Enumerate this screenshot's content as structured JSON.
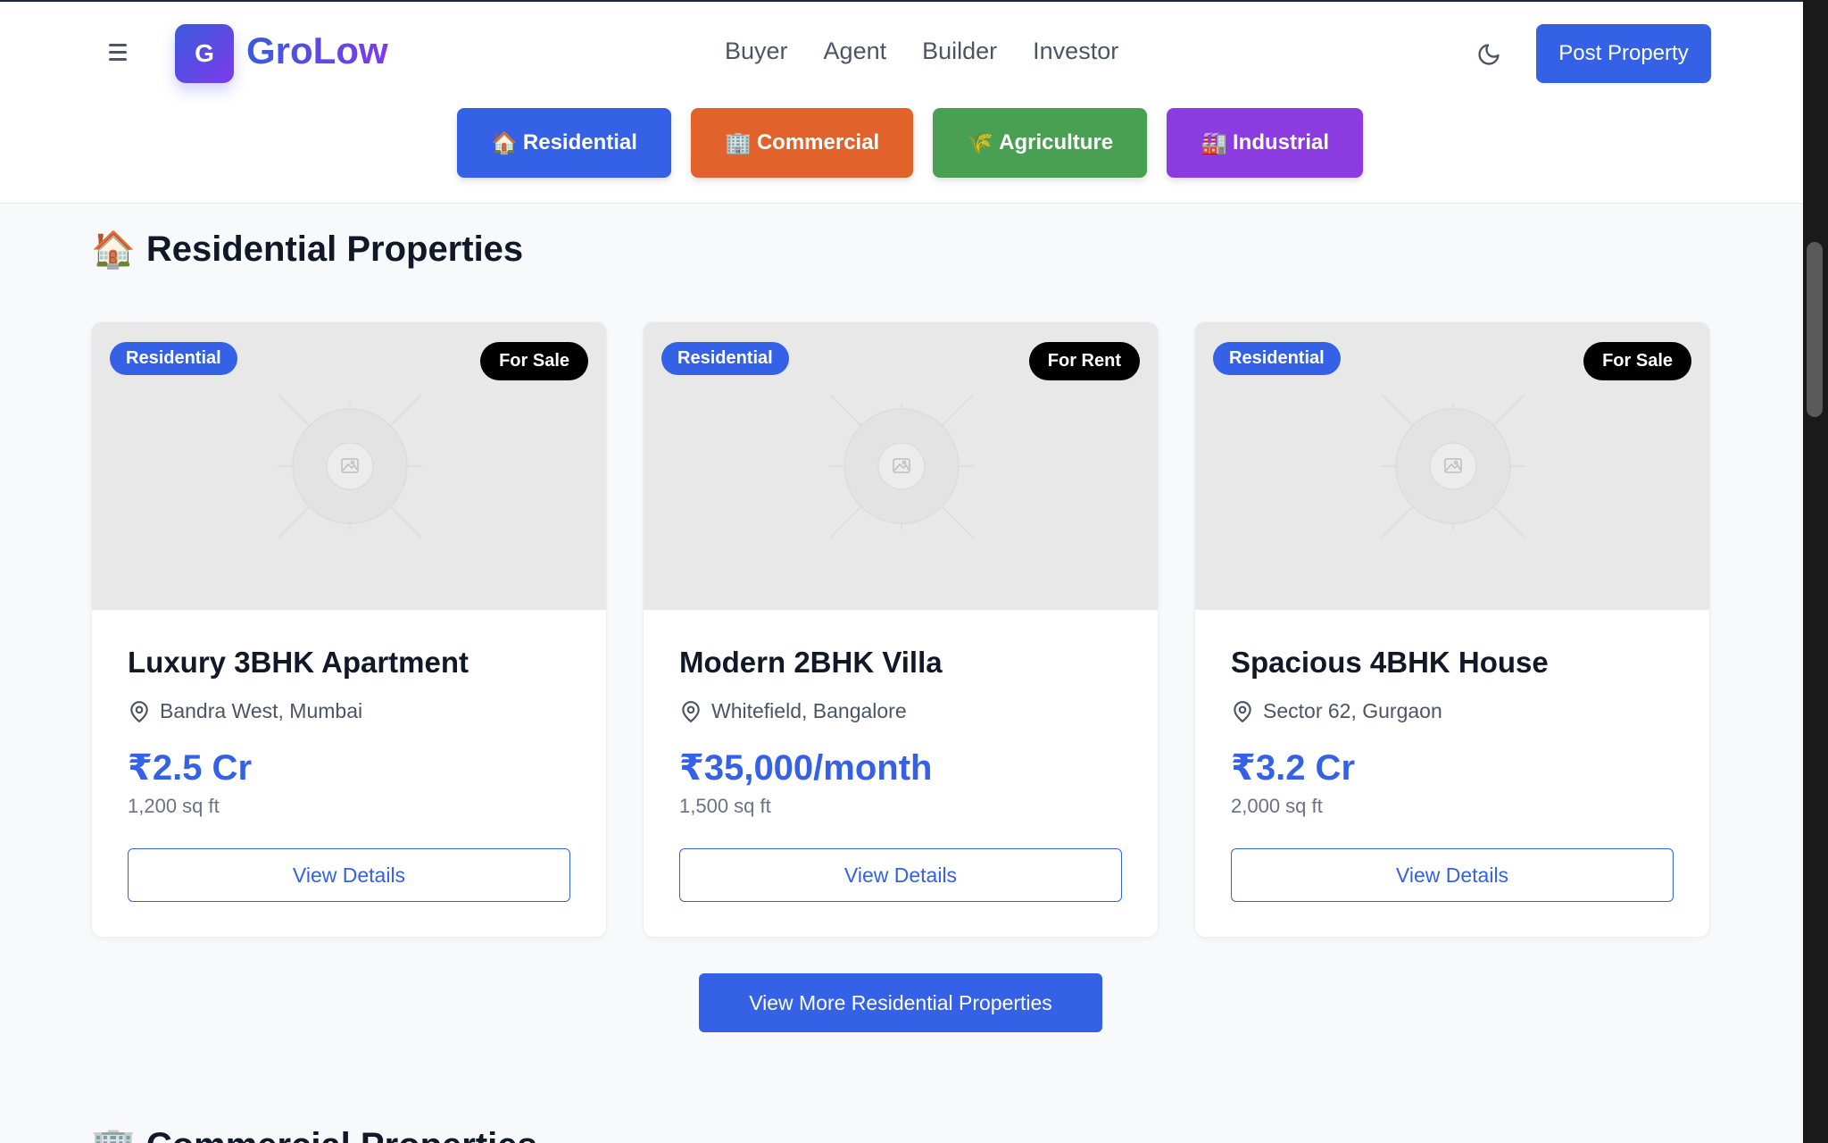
{
  "header": {
    "logo_letter": "G",
    "brand": "GroLow",
    "nav": [
      "Buyer",
      "Agent",
      "Builder",
      "Investor"
    ],
    "post_property": "Post Property"
  },
  "categories": [
    {
      "icon": "🏠",
      "label": "Residential",
      "color": "#3461e6"
    },
    {
      "icon": "🏢",
      "label": "Commercial",
      "color": "#e2622b"
    },
    {
      "icon": "🌾",
      "label": "Agriculture",
      "color": "#4aa052"
    },
    {
      "icon": "🏭",
      "label": "Industrial",
      "color": "#8c3be0"
    }
  ],
  "section": {
    "icon": "🏠",
    "title": "Residential Properties",
    "view_more": "View More Residential Properties"
  },
  "properties": [
    {
      "type": "Residential",
      "status": "For Sale",
      "title": "Luxury 3BHK Apartment",
      "location": "Bandra West, Mumbai",
      "price": "₹2.5 Cr",
      "area": "1,200 sq ft",
      "action": "View Details"
    },
    {
      "type": "Residential",
      "status": "For Rent",
      "title": "Modern 2BHK Villa",
      "location": "Whitefield, Bangalore",
      "price": "₹35,000/month",
      "area": "1,500 sq ft",
      "action": "View Details"
    },
    {
      "type": "Residential",
      "status": "For Sale",
      "title": "Spacious 4BHK House",
      "location": "Sector 62, Gurgaon",
      "price": "₹3.2 Cr",
      "area": "2,000 sq ft",
      "action": "View Details"
    }
  ],
  "next_section": {
    "icon": "🏢",
    "title": "Commercial Properties"
  },
  "colors": {
    "primary": "#3461e6",
    "brand_gradient_start": "#3b5bdb",
    "brand_gradient_end": "#7c3aed"
  }
}
